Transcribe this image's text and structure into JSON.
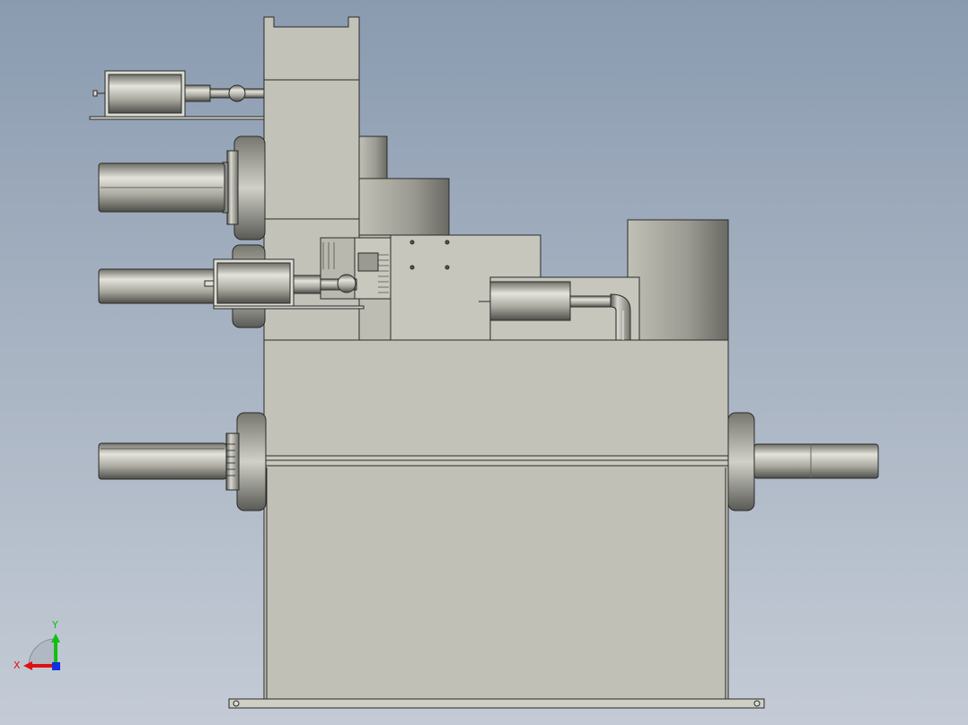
{
  "colors": {
    "background_top": "#8a9bb0",
    "background_bottom": "#c4cbd6",
    "body_fill": "#c2c2b8",
    "edge": "#2a2a2a",
    "axis_x": "#e01010",
    "axis_y": "#10c010",
    "axis_z": "#1030e0"
  },
  "triad": {
    "x_label": "X",
    "y_label": "Y"
  }
}
